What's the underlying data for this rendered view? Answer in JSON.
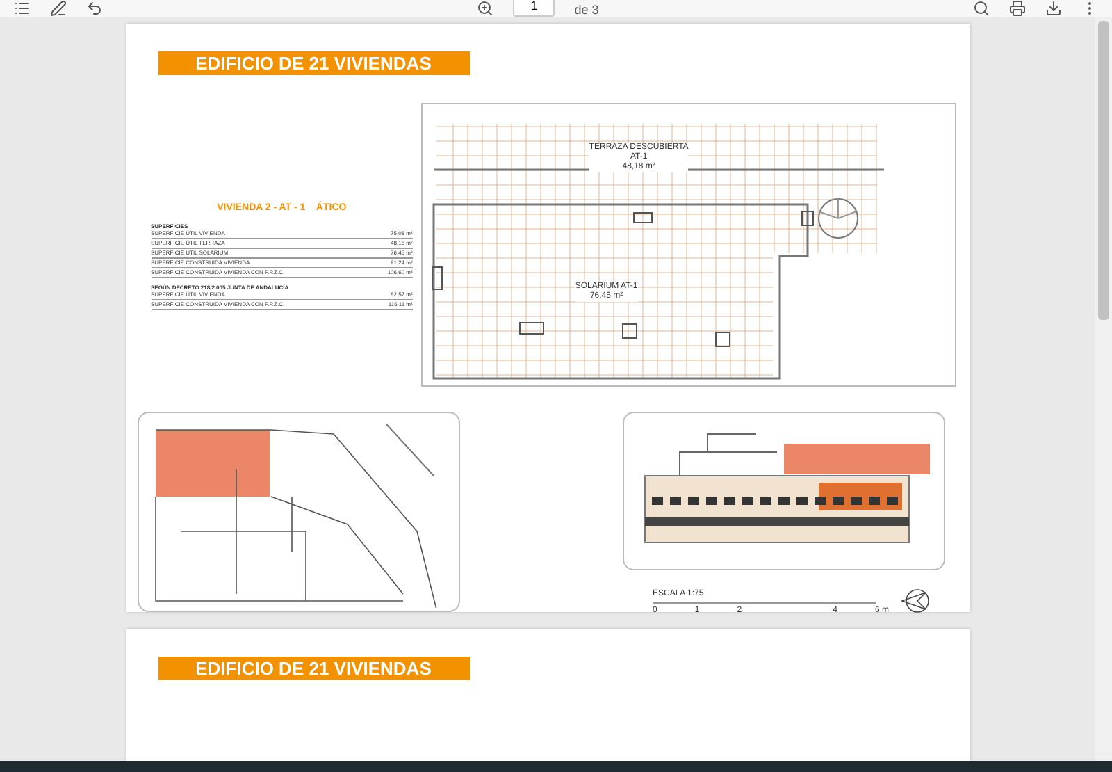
{
  "toolbar": {
    "page_input": "1",
    "page_total": "de 3"
  },
  "pages": [
    {
      "title": "EDIFICIO DE 21 VIVIENDAS",
      "unit_title": "VIVIENDA 2 - AT - 1 _ ÁTICO",
      "sections": [
        {
          "heading": "SUPERFICIES",
          "rows": [
            {
              "label": "SUPERFICIE ÚTIL VIVIENDA",
              "value": "75,08 m²"
            },
            {
              "label": "SUPERFICIE ÚTIL TERRAZA",
              "value": "48,18 m²"
            },
            {
              "label": "SUPERFICIE ÚTIL SOLARIUM",
              "value": "76,45 m²"
            }
          ]
        },
        {
          "rows": [
            {
              "label": "SUPERFICIE CONSTRUIDA VIVIENDA",
              "value": "91,24 m²"
            },
            {
              "label": "SUPERFICIE CONSTRUIDA VIVIENDA CON P.P.Z.C.",
              "value": "106,60 m²"
            }
          ]
        },
        {
          "heading": "SEGÚN DECRETO 218/2.005 JUNTA DE ANDALUCÍA",
          "rows": [
            {
              "label": "SUPERFICIE ÚTIL VIVIENDA",
              "value": "82,57 m²"
            },
            {
              "label": "SUPERFICIE CONSTRUIDA VIVIENDA CON P.P.Z.C.",
              "value": "116,11 m²"
            }
          ]
        }
      ],
      "plan_labels": [
        {
          "lines": [
            "TERRAZA DESCUBIERTA",
            "AT-1",
            "48,18 m²"
          ]
        },
        {
          "lines": [
            "SOLARIUM AT-1",
            "76,45 m²"
          ]
        }
      ],
      "scale": {
        "title": "ESCALA 1:75",
        "ticks": [
          "0",
          "1",
          "2",
          "4",
          "6 m"
        ]
      }
    },
    {
      "title": "EDIFICIO DE 21 VIVIENDAS"
    }
  ]
}
